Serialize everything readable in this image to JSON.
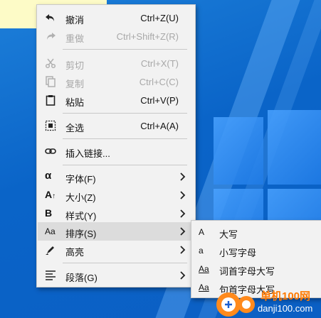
{
  "menu": {
    "items": [
      {
        "icon": "undo-icon",
        "label": "撤消",
        "shortcut": "Ctrl+Z(U)",
        "disabled": false
      },
      {
        "icon": "redo-icon",
        "label": "重做",
        "shortcut": "Ctrl+Shift+Z(R)",
        "disabled": true
      },
      {
        "icon": "scissors-icon",
        "label": "剪切",
        "shortcut": "Ctrl+X(T)",
        "disabled": true
      },
      {
        "icon": "copy-icon",
        "label": "复制",
        "shortcut": "Ctrl+C(C)",
        "disabled": true
      },
      {
        "icon": "clipboard-icon",
        "label": "粘贴",
        "shortcut": "Ctrl+V(P)",
        "disabled": false
      },
      {
        "icon": "select-all-icon",
        "label": "全选",
        "shortcut": "Ctrl+A(A)",
        "disabled": false
      },
      {
        "icon": "link-icon",
        "label": "插入链接..."
      },
      {
        "icon": "alpha-icon",
        "label": "字体(F)",
        "has_submenu": true
      },
      {
        "icon": "font-size-icon",
        "label": "大小(Z)",
        "has_submenu": true
      },
      {
        "icon": "bold-icon",
        "label": "样式(Y)",
        "has_submenu": true
      },
      {
        "icon": "case-icon",
        "label": "排序(S)",
        "has_submenu": true,
        "highlighted": true
      },
      {
        "icon": "highlighter-icon",
        "label": "高亮",
        "has_submenu": true
      },
      {
        "icon": "paragraph-icon",
        "label": "段落(G)",
        "has_submenu": true
      }
    ],
    "icon_glyphs": {
      "alpha": "α",
      "bold": "B",
      "case": "Aa",
      "font_size": "A"
    }
  },
  "submenu": {
    "items": [
      {
        "icon": "uppercase-icon",
        "glyph": "A",
        "label": "大写"
      },
      {
        "icon": "lowercase-icon",
        "glyph": "a",
        "label": "小写字母"
      },
      {
        "icon": "title-case-icon",
        "glyph": "Aa",
        "label": "词首字母大写"
      },
      {
        "icon": "sentence-case-icon",
        "glyph": "Aa",
        "label": "句首字母大写"
      }
    ]
  },
  "watermark": {
    "text": "单机100网",
    "url": "danji100.com"
  },
  "colors": {
    "desktop": "#0a64c8",
    "menu_bg": "#f2f2f2",
    "highlight": "#dcdcdc",
    "disabled": "#a8a8a8",
    "note": "#fdfbc7"
  }
}
